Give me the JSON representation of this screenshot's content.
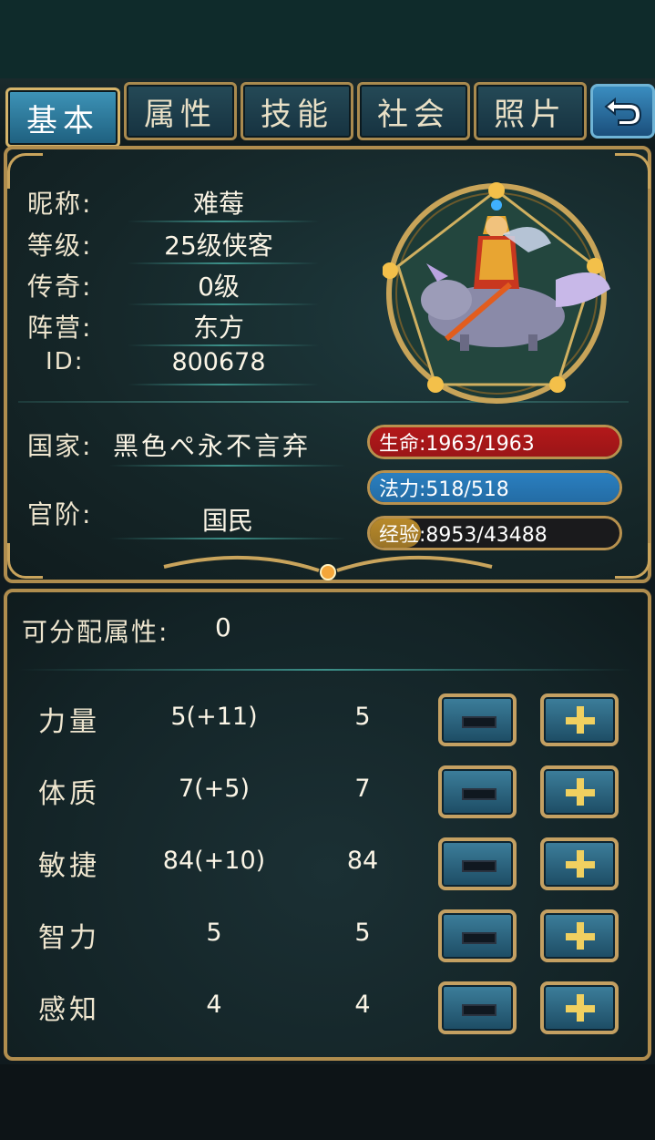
{
  "tabs": [
    {
      "label": "基本",
      "active": true
    },
    {
      "label": "属性"
    },
    {
      "label": "技能"
    },
    {
      "label": "社会"
    },
    {
      "label": "照片"
    }
  ],
  "profile": {
    "nickname_label": "昵称:",
    "nickname": "难莓",
    "level_label": "等级:",
    "level": "25级侠客",
    "legend_label": "传奇:",
    "legend": "0级",
    "faction_label": "阵营:",
    "faction": "东方",
    "id_label": "ID:",
    "id": "800678",
    "country_label": "国家:",
    "country": "黑色ぺ永不言弃",
    "rank_label": "官阶:",
    "rank": "国民"
  },
  "stats": {
    "hp": {
      "label": "生命:1963/1963",
      "current": 1963,
      "max": 1963,
      "color": "#b3181a"
    },
    "mp": {
      "label": "法力:518/518",
      "current": 518,
      "max": 518,
      "color": "#2a7fc0"
    },
    "exp": {
      "label": "经验:8953/43488",
      "current": 8953,
      "max": 43488,
      "color": "#b98a2a"
    }
  },
  "attributes": {
    "alloc_label": "可分配属性:",
    "alloc_value": "0",
    "rows": [
      {
        "name": "力量",
        "current": "5(+11)",
        "base": "5"
      },
      {
        "name": "体质",
        "current": "7(+5)",
        "base": "7"
      },
      {
        "name": "敏捷",
        "current": "84(+10)",
        "base": "84"
      },
      {
        "name": "智力",
        "current": "5",
        "base": "5"
      },
      {
        "name": "感知",
        "current": "4",
        "base": "4"
      }
    ]
  },
  "icons": {
    "back": "back-arrow-icon",
    "minus": "minus-icon",
    "plus": "plus-icon"
  }
}
